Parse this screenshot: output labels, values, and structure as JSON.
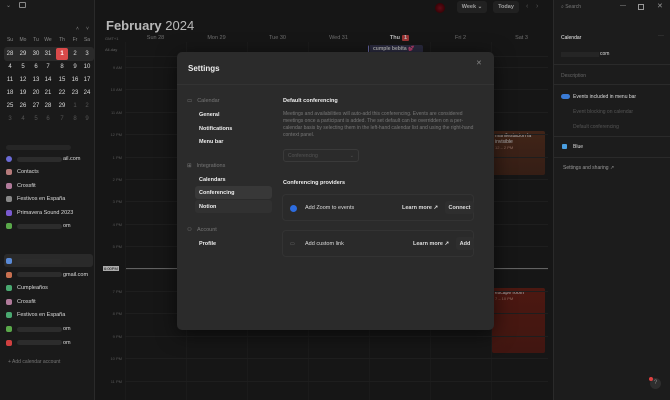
{
  "sidebar": {
    "weekdays": [
      "Su",
      "Mo",
      "Tu",
      "We",
      "Th",
      "Fr",
      "Sa"
    ],
    "weeks": [
      [
        "28",
        "29",
        "30",
        "31",
        "1",
        "2",
        "3"
      ],
      [
        "4",
        "5",
        "6",
        "7",
        "8",
        "9",
        "10"
      ],
      [
        "11",
        "12",
        "13",
        "14",
        "15",
        "16",
        "17"
      ],
      [
        "18",
        "19",
        "20",
        "21",
        "22",
        "23",
        "24"
      ],
      [
        "25",
        "26",
        "27",
        "28",
        "29",
        "1",
        "2"
      ],
      [
        "3",
        "4",
        "5",
        "6",
        "7",
        "8",
        "9"
      ]
    ],
    "group1": [
      {
        "label": "ail.com",
        "color": "#6b6bd6"
      },
      {
        "label": "Contacts",
        "color": "#b57a7a"
      },
      {
        "label": "Crossfit",
        "color": "#b07a9a"
      },
      {
        "label": "Festivos en España",
        "color": "#888"
      },
      {
        "label": "Primavera Sound 2023",
        "color": "#7a5ad0"
      },
      {
        "label": "om",
        "color": "#5aa84a"
      }
    ],
    "group2": [
      {
        "label": "",
        "color": "#5a8ad6"
      },
      {
        "label": "gmail.com",
        "color": "#c87050"
      },
      {
        "label": "Cumpleaños",
        "color": "#4aa870"
      },
      {
        "label": "Crossfit",
        "color": "#b07a9a"
      },
      {
        "label": "Festivos en España",
        "color": "#4aa870"
      },
      {
        "label": "om",
        "color": "#5aa84a"
      },
      {
        "label": "om",
        "color": "#d04040"
      }
    ],
    "add_account": "Add calendar account"
  },
  "header": {
    "month": "February",
    "year": "2024",
    "view": "Week",
    "today": "Today",
    "tz": "GMT+1",
    "allday": "All-day",
    "days": [
      "Sun 28",
      "Mon 29",
      "Tue 30",
      "Wed 31",
      "Thu",
      "Fri 2",
      "Sat 3"
    ],
    "today_badge": "1",
    "hours": [
      "9 AM",
      "10 AM",
      "11 AM",
      "12 PM",
      "1 PM",
      "2 PM",
      "3 PM",
      "4 PM",
      "5 PM",
      "",
      "7 PM",
      "8 PM",
      "9 PM",
      "10 PM",
      "11 PM"
    ],
    "now": "6:00PM"
  },
  "events": [
    {
      "title": "cumple bebita 💕",
      "time": ""
    },
    {
      "title": "manifestacion la invisible",
      "time": "12 – 2 PM"
    },
    {
      "title": "escape room",
      "time": "7 – 10 PM"
    }
  ],
  "right_panel": {
    "search": "Search",
    "title": "Calendar",
    "account": "com",
    "description": "Description",
    "toggle1": "Events included in menu bar",
    "opt2": "Event blocking on calendar",
    "opt3": "Default conferencing",
    "color": "Blue",
    "settings_link": "Settings and sharing"
  },
  "modal": {
    "title": "Settings",
    "sections": [
      {
        "label": "Calendar",
        "items": [
          "General",
          "Notifications",
          "Menu bar"
        ]
      },
      {
        "label": "Integrations",
        "items": [
          "Calendars",
          "Conferencing",
          "Notion"
        ]
      },
      {
        "label": "Account",
        "items": [
          "Profile"
        ]
      }
    ],
    "heading": "Default conferencing",
    "description": "Meetings and availabilities will auto-add this conferencing. Events are considered meetings once a participant is added. The set default can be overridden on a per-calendar basis by selecting them in the left-hand calendar list and using the right-hand context panel.",
    "select_placeholder": "Conferencing",
    "providers_heading": "Conferencing providers",
    "zoom_label": "Add Zoom to events",
    "learn_more": "Learn more",
    "connect": "Connect",
    "custom_label": "Add custom link",
    "add": "Add"
  },
  "colors": {
    "accent": "#d94a4a",
    "event_orange": "#5a3322",
    "event_red": "#6a2218"
  }
}
